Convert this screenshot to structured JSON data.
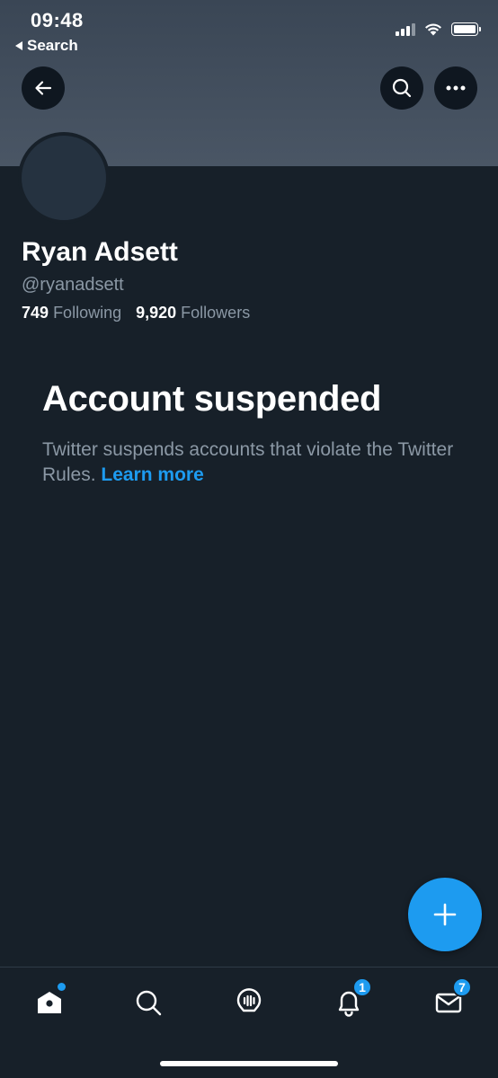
{
  "status_bar": {
    "time": "09:48",
    "back_label": "Search"
  },
  "profile": {
    "name": "Ryan Adsett",
    "handle": "@ryanadsett",
    "following_count": "749",
    "following_label": "Following",
    "followers_count": "9,920",
    "followers_label": "Followers"
  },
  "suspension": {
    "title": "Account suspended",
    "message": "Twitter suspends accounts that violate the Twitter Rules.",
    "link_text": "Learn more"
  },
  "bottom_nav": {
    "items": [
      {
        "icon": "home-icon",
        "has_dot": true
      },
      {
        "icon": "search-icon"
      },
      {
        "icon": "spaces-icon"
      },
      {
        "icon": "notifications-icon",
        "badge": "1"
      },
      {
        "icon": "messages-icon",
        "badge": "7"
      }
    ]
  },
  "colors": {
    "accent": "#1d9bf0",
    "background": "#172029",
    "banner": "#3a4655",
    "secondary_text": "#8b98a5"
  }
}
